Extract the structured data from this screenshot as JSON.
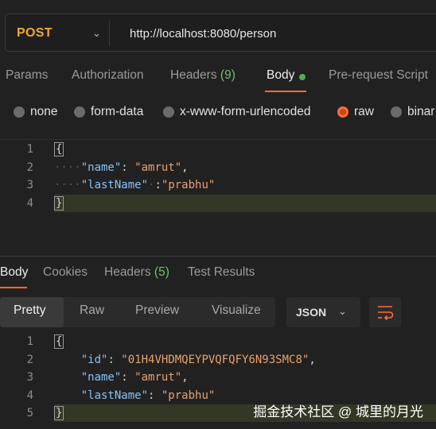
{
  "request": {
    "method": "POST",
    "url": "http://localhost:8080/person"
  },
  "request_tabs": [
    {
      "label": "Params"
    },
    {
      "label": "Authorization"
    },
    {
      "label": "Headers",
      "count": "(9)"
    },
    {
      "label": "Body"
    },
    {
      "label": "Pre-request Script"
    }
  ],
  "body_types": [
    "none",
    "form-data",
    "x-www-form-urlencoded",
    "raw",
    "binar"
  ],
  "body_selected": "raw",
  "request_body": {
    "line_numbers": [
      "1",
      "2",
      "3",
      "4"
    ],
    "open": "{",
    "close": "}",
    "key1": "\"name\"",
    "val1": "\"amrut\"",
    "key2": "\"lastName\"",
    "val2": "\"prabhu\""
  },
  "response_tabs": [
    {
      "label": "Body"
    },
    {
      "label": "Cookies"
    },
    {
      "label": "Headers",
      "count": "(5)"
    },
    {
      "label": "Test Results"
    }
  ],
  "view_modes": [
    "Pretty",
    "Raw",
    "Preview",
    "Visualize"
  ],
  "format": "JSON",
  "response_body": {
    "line_numbers": [
      "1",
      "2",
      "3",
      "4",
      "5"
    ],
    "open": "{",
    "close": "}",
    "key1": "\"id\"",
    "val1": "\"01H4VHDMQEYPVQFQFY6N93SMC8\"",
    "key2": "\"name\"",
    "val2": "\"amrut\"",
    "key3": "\"lastName\"",
    "val3": "\"prabhu\""
  },
  "watermark": "掘金技术社区 @ 城里的月光",
  "colors": {
    "accent": "#ff6c37",
    "method": "#f0a830",
    "json_key": "#86c1f5",
    "json_string": "#e8a070"
  }
}
